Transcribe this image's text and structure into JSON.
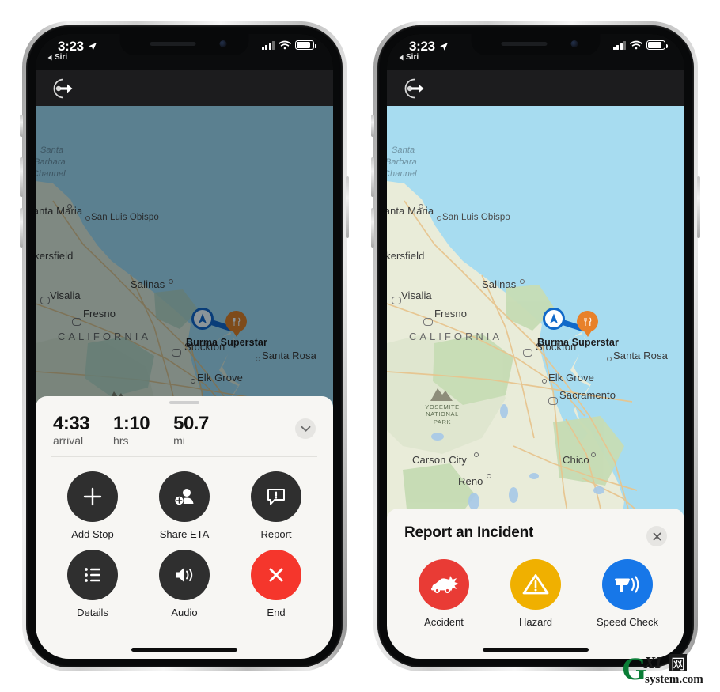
{
  "status_bar": {
    "time": "3:23",
    "back_app": "Siri",
    "location_arrow_icon": "location-arrow-icon",
    "signal_icon": "cellular-signal-icon",
    "wifi_icon": "wifi-icon",
    "battery_icon": "battery-icon"
  },
  "app_bar": {
    "exit_icon": "siri-exit-icon"
  },
  "map": {
    "destination_label": "Burma Superstar",
    "state_label": "CALIFORNIA",
    "sea_label_line1": "Santa",
    "sea_label_line2": "Barbara",
    "sea_label_line3": "Channel",
    "user_puck_icon": "navigation-arrow-icon",
    "destination_pin_icon": "restaurant-pin-icon",
    "park_label": "YOSEMITE\nNATIONAL\nPARK",
    "cities_left": [
      "Santa Maria",
      "San Luis Obispo",
      "Bakersfield",
      "Visalia",
      "Fresno",
      "Salinas",
      "Stockton",
      "Santa Rosa",
      "Elk Grove"
    ],
    "cities_right": [
      "Santa Maria",
      "San Luis Obispo",
      "Bakersfield",
      "Visalia",
      "Fresno",
      "Salinas",
      "Stockton",
      "Santa Rosa",
      "Elk Grove",
      "Sacramento",
      "Carson City",
      "Reno",
      "Chico"
    ],
    "colors": {
      "sea_bright": "#a7dcf0",
      "land": "#e9ecd9",
      "route": "#1069c9",
      "pin": "#e8812a"
    }
  },
  "left_phone": {
    "eta": [
      {
        "value": "4:33",
        "unit": "arrival"
      },
      {
        "value": "1:10",
        "unit": "hrs"
      },
      {
        "value": "50.7",
        "unit": "mi"
      }
    ],
    "collapse_icon": "chevron-down-icon",
    "actions": [
      {
        "label": "Add Stop",
        "icon": "plus-icon",
        "color": "#2f2f2f"
      },
      {
        "label": "Share ETA",
        "icon": "person-add-icon",
        "color": "#2f2f2f"
      },
      {
        "label": "Report",
        "icon": "report-bubble-icon",
        "color": "#2f2f2f"
      },
      {
        "label": "Details",
        "icon": "list-icon",
        "color": "#2f2f2f"
      },
      {
        "label": "Audio",
        "icon": "speaker-wave-icon",
        "color": "#2f2f2f"
      },
      {
        "label": "End",
        "icon": "x-close-icon",
        "color": "#f5362c"
      }
    ]
  },
  "right_phone": {
    "sheet_title": "Report an Incident",
    "close_icon": "x-close-icon",
    "incidents": [
      {
        "label": "Accident",
        "icon": "car-crash-icon",
        "color": "#e93b35"
      },
      {
        "label": "Hazard",
        "icon": "warning-triangle-icon",
        "color": "#f0b000"
      },
      {
        "label": "Speed Check",
        "icon": "speed-camera-icon",
        "color": "#1777e8"
      }
    ]
  },
  "watermark": {
    "main": "GXI",
    "cjk": "网",
    "sub": "system.com"
  }
}
